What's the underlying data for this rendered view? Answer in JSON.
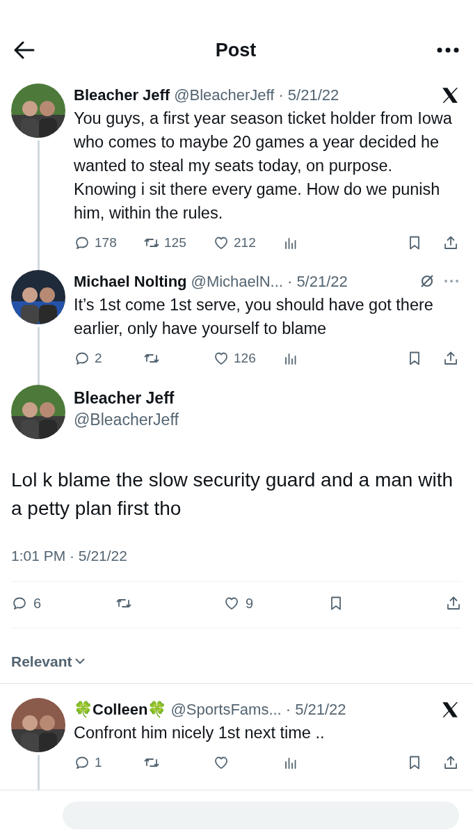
{
  "header": {
    "title": "Post"
  },
  "thread": [
    {
      "name": "Bleacher Jeff",
      "handle": "@BleacherJeff",
      "date": "· 5/21/22",
      "kind": "x",
      "text": "You guys, a first year season ticket holder from Iowa who comes to maybe 20 games a year decided he wanted to steal my seats today, on purpose. Knowing i sit there every game. How do we punish him, within the rules.",
      "replies": "178",
      "retweets": "125",
      "likes": "212"
    },
    {
      "name": "Michael Nolting",
      "handle": "@MichaelN...",
      "date": "· 5/21/22",
      "kind": "grok",
      "text": "It’s 1st come 1st serve, you should have got there earlier, only have yourself to blame",
      "replies": "2",
      "likes": "126"
    }
  ],
  "post": {
    "name": "Bleacher Jeff",
    "handle": "@BleacherJeff",
    "text": "Lol k blame the slow security guard and a man with a petty plan first tho",
    "time": "1:01 PM · 5/21/22",
    "replies": "6",
    "likes": "9"
  },
  "sort": {
    "label": "Relevant"
  },
  "replies": [
    {
      "name": "🍀Colleen🍀",
      "handle": "@SportsFams...",
      "date": "· 5/21/22",
      "kind": "x",
      "text": "Confront him nicely 1st  next time ..",
      "replies": "1"
    }
  ]
}
